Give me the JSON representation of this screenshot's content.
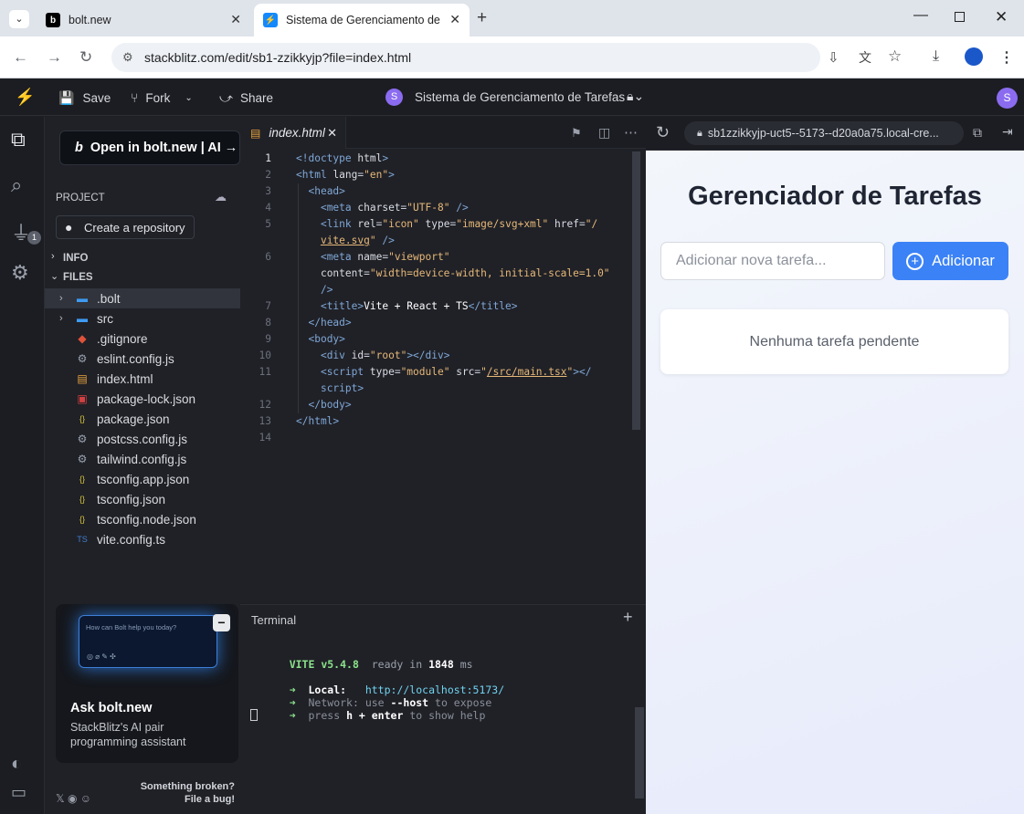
{
  "browser": {
    "tabs": [
      {
        "title": "bolt.new"
      },
      {
        "title": "Sistema de Gerenciamento de T"
      }
    ],
    "url": "stackblitz.com/edit/sb1-zzikkyjp?file=index.html"
  },
  "header": {
    "save": "Save",
    "fork": "Fork",
    "share": "Share",
    "project_initial": "S",
    "project_title": "Sistema de Gerenciamento de Tarefas",
    "user_initial": "S"
  },
  "activity": {
    "badge": "1"
  },
  "sidebar": {
    "bolt_button": "Open in bolt.new | AI →",
    "project_label": "PROJECT",
    "create_repo": "Create a repository",
    "info_label": "INFO",
    "files_label": "FILES",
    "files": [
      {
        "name": ".bolt",
        "icon": "folder-icon",
        "type": "folder"
      },
      {
        "name": "src",
        "icon": "folder-icon",
        "type": "folder"
      },
      {
        "name": ".gitignore",
        "icon": "git-icon",
        "type": "file"
      },
      {
        "name": "eslint.config.js",
        "icon": "gear-icon",
        "type": "file"
      },
      {
        "name": "index.html",
        "icon": "html5-icon",
        "type": "file"
      },
      {
        "name": "package-lock.json",
        "icon": "npm-icon",
        "type": "file"
      },
      {
        "name": "package.json",
        "icon": "json-icon",
        "type": "file"
      },
      {
        "name": "postcss.config.js",
        "icon": "gear-icon",
        "type": "file"
      },
      {
        "name": "tailwind.config.js",
        "icon": "gear-icon",
        "type": "file"
      },
      {
        "name": "tsconfig.app.json",
        "icon": "json-icon",
        "type": "file"
      },
      {
        "name": "tsconfig.json",
        "icon": "json-icon",
        "type": "file"
      },
      {
        "name": "tsconfig.node.json",
        "icon": "json-icon",
        "type": "file"
      },
      {
        "name": "vite.config.ts",
        "icon": "typescript-icon",
        "type": "file"
      }
    ],
    "promo": {
      "placeholder": "How can Bolt help you today?",
      "title": "Ask bolt.new",
      "subtitle_line1": "StackBlitz's AI pair",
      "subtitle_line2": "programming assistant"
    },
    "footer": {
      "line1": "Something broken?",
      "line2": "File a bug!"
    }
  },
  "editor": {
    "tab": "index.html",
    "line_numbers": [
      "1",
      "2",
      "3",
      "4",
      "5",
      "6",
      "7",
      "8",
      "9",
      "10",
      "11",
      "12",
      "13",
      "14"
    ]
  },
  "terminal": {
    "title": "Terminal",
    "vite": "VITE v5.4.8",
    "ready": "ready in",
    "ms": "1848",
    "ms_unit": "ms",
    "local_label": "Local:",
    "local_url": "http://localhost:5173/",
    "network_label": "Network:",
    "network_text": "use",
    "network_flag": "--host",
    "network_rest": "to expose",
    "help_pre": "press",
    "help_key": "h + enter",
    "help_rest": "to show help"
  },
  "preview": {
    "url": "sb1zzikkyjp-uct5--5173--d20a0a75.local-cre...",
    "title": "Gerenciador de Tarefas",
    "input_placeholder": "Adicionar nova tarefa...",
    "add_button": "Adicionar",
    "empty_text": "Nenhuma tarefa pendente"
  },
  "colors": {
    "accent": "#3b82f6",
    "bolt_blue": "#1389fd",
    "avatar": "#8b6cf0"
  }
}
